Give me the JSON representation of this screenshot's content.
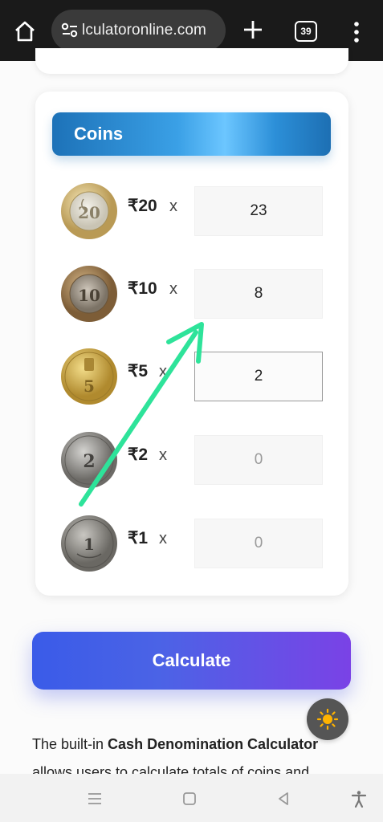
{
  "browser": {
    "url": "lculatoronline.com",
    "tab_count": "39"
  },
  "coins": {
    "title": "Coins",
    "rows": [
      {
        "label": "₹20",
        "x": "x",
        "value": "23",
        "coin_icon": "coin-20-icon"
      },
      {
        "label": "₹10",
        "x": "x",
        "value": "8",
        "coin_icon": "coin-10-icon"
      },
      {
        "label": "₹5",
        "x": "x",
        "value": "2",
        "coin_icon": "coin-5-icon"
      },
      {
        "label": "₹2",
        "x": "x",
        "value": "0",
        "coin_icon": "coin-2-icon"
      },
      {
        "label": "₹1",
        "x": "x",
        "value": "0",
        "coin_icon": "coin-1-icon"
      }
    ]
  },
  "calculate_label": "Calculate",
  "description": {
    "part1": "The built-in ",
    "bold": "Cash Denomination Calculator",
    "part2": " allows users to calculate totals of coins and"
  },
  "colors": {
    "header_blue": "#1d72b8",
    "button_start": "#3a5be8",
    "button_end": "#7a42e6",
    "arrow_green": "#2ee39a"
  }
}
